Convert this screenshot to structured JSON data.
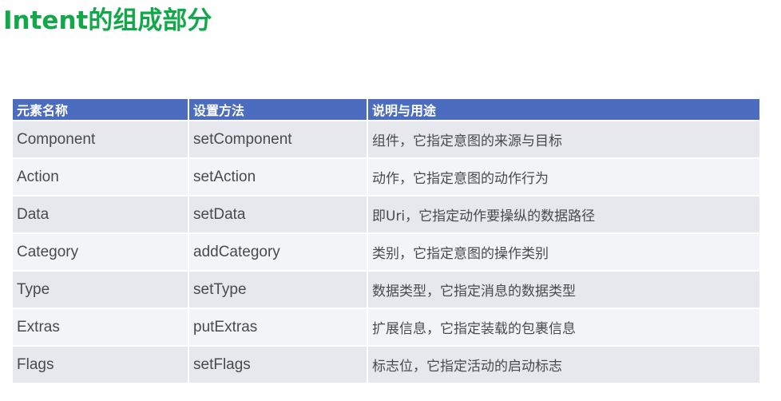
{
  "title": "Intent的组成部分",
  "table": {
    "headers": [
      "元素名称",
      "设置方法",
      "说明与用途"
    ],
    "rows": [
      [
        "Component",
        "setComponent",
        "组件，它指定意图的来源与目标"
      ],
      [
        "Action",
        "setAction",
        "动作，它指定意图的动作行为"
      ],
      [
        "Data",
        "setData",
        "即Uri，它指定动作要操纵的数据路径"
      ],
      [
        "Category",
        "addCategory",
        "类别，它指定意图的操作类别"
      ],
      [
        "Type",
        "setType",
        "数据类型，它指定消息的数据类型"
      ],
      [
        "Extras",
        "putExtras",
        "扩展信息，它指定装载的包裹信息"
      ],
      [
        "Flags",
        "setFlags",
        "标志位，它指定活动的启动标志"
      ]
    ]
  },
  "colors": {
    "title": "#12a84a",
    "header_bg": "#4b6cbf",
    "row_odd": "#e6e8ee",
    "row_even": "#f3f4f7"
  }
}
